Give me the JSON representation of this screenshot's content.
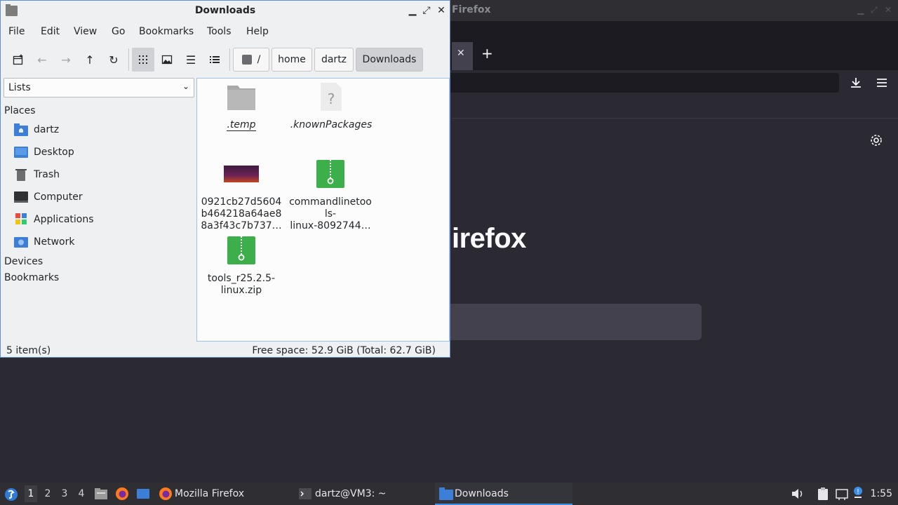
{
  "firefox": {
    "window_title": "Firefox",
    "brand_text": "irefox"
  },
  "file_manager": {
    "title": "Downloads",
    "menu": [
      "File",
      "Edit",
      "View",
      "Go",
      "Bookmarks",
      "Tools",
      "Help"
    ],
    "breadcrumbs": [
      "/",
      "home",
      "dartz",
      "Downloads"
    ],
    "side_combo": "Lists",
    "places_header": "Places",
    "places": [
      {
        "label": "dartz",
        "icon": "home-folder-icon"
      },
      {
        "label": "Desktop",
        "icon": "desktop-icon"
      },
      {
        "label": "Trash",
        "icon": "trash-icon"
      },
      {
        "label": "Computer",
        "icon": "computer-icon"
      },
      {
        "label": "Applications",
        "icon": "applications-icon"
      },
      {
        "label": "Network",
        "icon": "network-icon"
      }
    ],
    "devices_header": "Devices",
    "bookmarks_header": "Bookmarks",
    "files": [
      {
        "name": ".temp",
        "type": "folder"
      },
      {
        "name": ".knownPackages",
        "type": "unknown"
      },
      {
        "name": "0921cb27d5604\nb464218a64ae8\n8a3f43c7b737…",
        "type": "image"
      },
      {
        "name": "commandlinetoo\nls-\nlinux-8092744…",
        "type": "zip"
      },
      {
        "name": "tools_r25.2.5-\nlinux.zip",
        "type": "zip"
      }
    ],
    "status_left": "5 item(s)",
    "status_right": "Free space: 52.9 GiB (Total: 62.7 GiB)"
  },
  "taskbar": {
    "workspaces": [
      "1",
      "2",
      "3",
      "4"
    ],
    "tasks": [
      {
        "label": "Mozilla Firefox"
      },
      {
        "label": "dartz@VM3: ~"
      },
      {
        "label": "Downloads"
      }
    ],
    "clock": "1:55"
  },
  "colors": {
    "accent": "#3d8ee6",
    "zip_green": "#3daf4a",
    "folder_grey": "#a8a8a8"
  }
}
